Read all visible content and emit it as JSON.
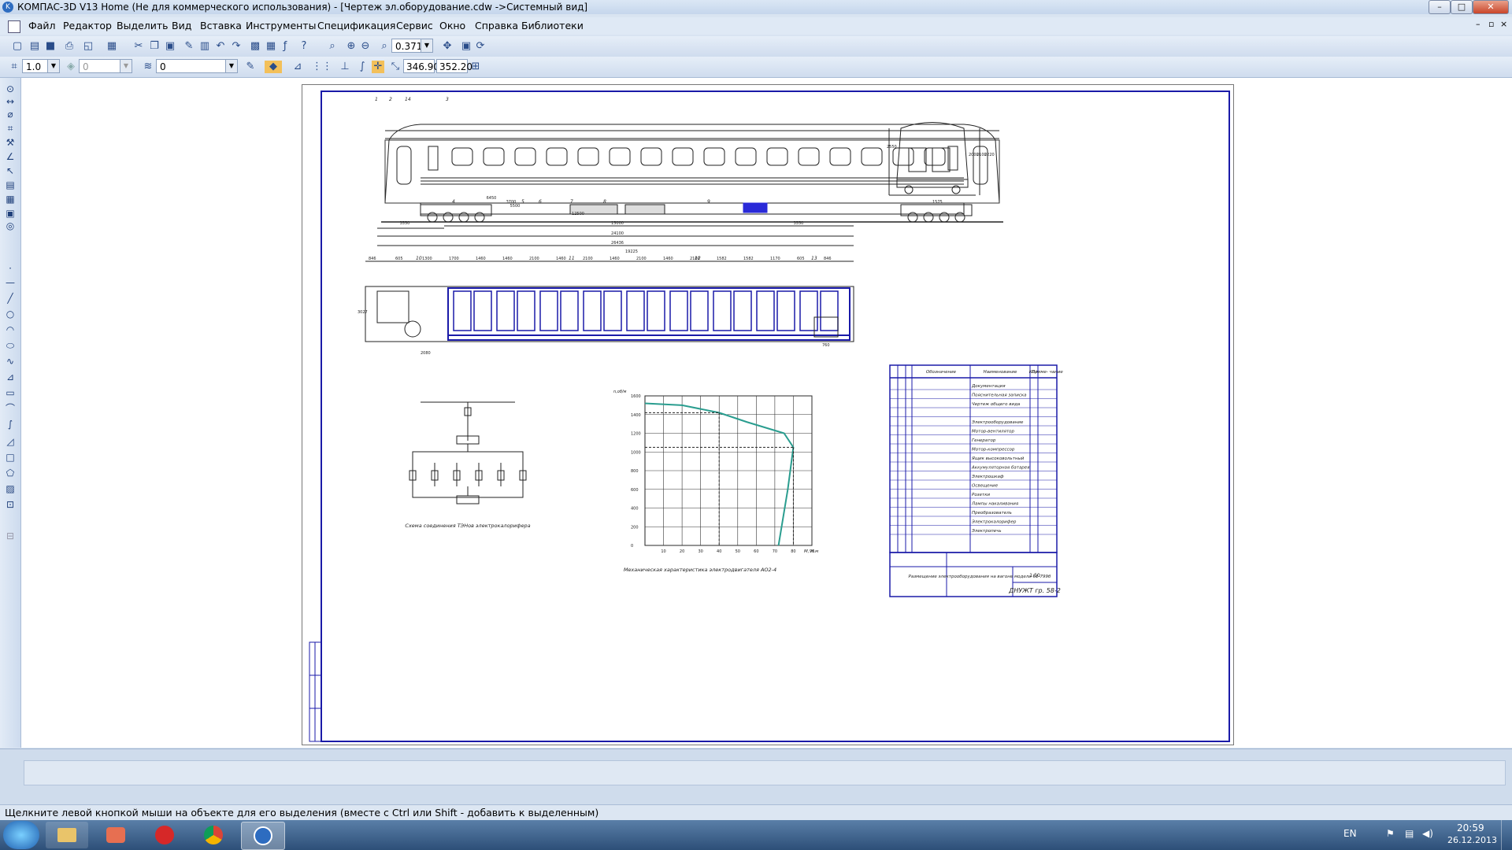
{
  "window": {
    "title": "КОМПАС-3D V13 Home (Не для коммерческого использования) - [Чертеж эл.оборудование.cdw ->Системный вид]",
    "minimize": "–",
    "maximize": "□",
    "close": "✕"
  },
  "menu": [
    "Файл",
    "Редактор",
    "Выделить",
    "Вид",
    "Вставка",
    "Инструменты",
    "Спецификация",
    "Сервис",
    "Окно",
    "Справка",
    "Библиотеки"
  ],
  "toolbar": {
    "zoom": "0.3716",
    "scale": "1.0",
    "layer": "0",
    "style": "0",
    "coord_x": "346.90",
    "coord_y": "352.20"
  },
  "drawing": {
    "callouts": [
      "1",
      "2",
      "14",
      "3",
      "4",
      "5",
      "6",
      "7",
      "8",
      "9",
      "10",
      "11",
      "12",
      "13"
    ],
    "dims_top": [
      "3550",
      "15000",
      "3550",
      "24100",
      "26436",
      "6450",
      "3700",
      "5500",
      "12500"
    ],
    "dims_end": [
      "2550",
      "2000",
      "2100",
      "2220",
      "1575"
    ],
    "dims_plan": [
      "846",
      "605",
      "1300",
      "1700",
      "1460",
      "1460",
      "2100",
      "1460",
      "2100",
      "1460",
      "2100",
      "1460",
      "2100",
      "1582",
      "1582",
      "1170",
      "605",
      "846",
      "19225",
      "2080",
      "760",
      "3027"
    ],
    "schematic_caption": "Схема соединения ТЭНов электрокалорифера",
    "chart_caption": "Механическая характеристика электродвигателя АО2-4",
    "chart_yaxis": "n,об/м",
    "chart_xaxis": "M, Н.м",
    "chart_yticks": [
      "0",
      "200",
      "400",
      "600",
      "800",
      "1000",
      "1200",
      "1400",
      "1600"
    ],
    "chart_xticks": [
      "10",
      "20",
      "30",
      "40",
      "50",
      "60",
      "70",
      "80",
      "90"
    ],
    "spec_headers": [
      "Обозначение",
      "Наименование",
      "Кол.",
      "Приме- чание"
    ],
    "spec_rows": [
      "Документация",
      "Пояснительная записка",
      "Чертеж общего вида",
      "",
      "Электрооборудование",
      "Мотор-вентилятор",
      "Генератор",
      "Мотор-компрессор",
      "Ящик высоковольтный",
      "Аккумуляторная батарея",
      "Электрошкаф",
      "Освещение",
      "Розетки",
      "Лампы накаливания",
      "Преобразователь",
      "Электрокалорифер",
      "Электропечь"
    ],
    "stamp_title": "Размещение электрооборудования на вагоне модели 61-799б",
    "stamp_code": "ДНУЖТ гр. 58-2",
    "stamp_sheet": "1:50"
  },
  "status": "Щелкните левой кнопкой мыши на объекте для его выделения (вместе с Ctrl или Shift - добавить к выделенным)",
  "tray": {
    "lang": "EN",
    "time": "20:59",
    "date": "26.12.2013"
  }
}
